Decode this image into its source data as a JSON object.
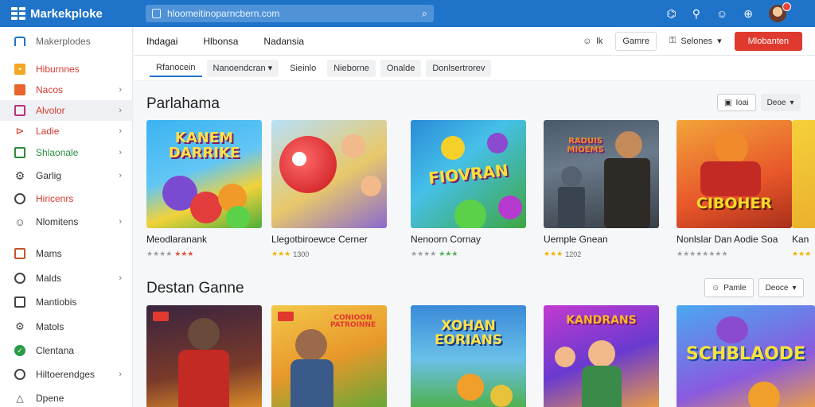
{
  "app": {
    "name": "Markekploke"
  },
  "search": {
    "value": "hloomeitinoparncbern.com"
  },
  "sidebar": {
    "items": [
      {
        "label": "Makerplodes",
        "icon": "home-icon"
      },
      {
        "label": "Hiburnnes",
        "icon": "flame-icon"
      },
      {
        "label": "Nacos",
        "icon": "bag-icon"
      },
      {
        "label": "Alvolor",
        "icon": "grid-icon"
      },
      {
        "label": "Ladie",
        "icon": "tag-icon"
      },
      {
        "label": "Shlaonale",
        "icon": "chart-icon"
      },
      {
        "label": "Garlig",
        "icon": "gear-icon"
      },
      {
        "label": "Hiricenrs",
        "icon": "target-icon"
      },
      {
        "label": "Nlomitens",
        "icon": "user-icon"
      },
      {
        "label": "Mams",
        "icon": "box-icon"
      },
      {
        "label": "Malds",
        "icon": "circle-icon"
      },
      {
        "label": "Mantiobis",
        "icon": "list-icon"
      },
      {
        "label": "Matols",
        "icon": "settings-icon"
      },
      {
        "label": "Clentana",
        "icon": "check-icon"
      },
      {
        "label": "Hiltoerendges",
        "icon": "info-icon"
      },
      {
        "label": "Dpene",
        "icon": "warning-icon"
      }
    ]
  },
  "header": {
    "tabs": [
      "Ihdagai",
      "Hlbonsa",
      "Nadansia"
    ],
    "user_button": "lk",
    "game_button": "Gamre",
    "selones_button": "Selones",
    "primary_button": "Mlobanten"
  },
  "filters": [
    "Rfanocein",
    "Nanoendcran",
    "Sieinlo",
    "Nieborne",
    "Onalde",
    "Donlsertrorev"
  ],
  "section1": {
    "title": "Parlahama",
    "btn1": "Ioai",
    "btn2": "Deoe",
    "cards": [
      {
        "name": "Meodlaranank",
        "rating": "",
        "art": "KANEM\nDARRIKE"
      },
      {
        "name": "Llegotbiroewce Cerner",
        "rating": "1300",
        "art": ""
      },
      {
        "name": "Nenoorn Cornay",
        "rating": "",
        "art": "FIOVRAN"
      },
      {
        "name": "Uemple Gnean",
        "rating": "1202",
        "art": "RADUIS\nMIOEMS"
      },
      {
        "name": "Nonlslar Dan Aodie  Soa",
        "rating": "",
        "art": "CIBOHER"
      },
      {
        "name": "Kan",
        "rating": "",
        "art": ""
      }
    ]
  },
  "section2": {
    "title": "Destan Ganne",
    "btn1": "Pamle",
    "btn2": "Deoce",
    "cards": [
      {
        "art": ""
      },
      {
        "art": "CONIOON\nPATROINNE"
      },
      {
        "art": "XOHAN\nEORIANS"
      },
      {
        "art": "KANDRANS"
      },
      {
        "art": "SCHBLAODE"
      }
    ]
  },
  "colors": {
    "topbar": "#1f73c9",
    "primary": "#e03a2f",
    "star": "#f0b400"
  }
}
